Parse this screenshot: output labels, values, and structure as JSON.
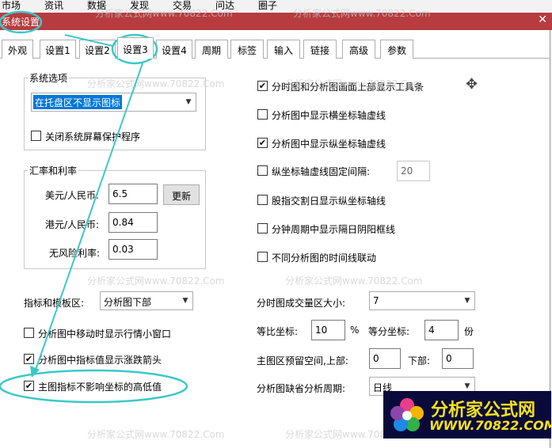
{
  "menubar": {
    "items": [
      "市场",
      "资讯",
      "数据",
      "发现",
      "交易",
      "问达",
      "圈子"
    ]
  },
  "window": {
    "title": "系统设置",
    "close_label": "✕"
  },
  "tabs": [
    "外观",
    "设置1",
    "设置2",
    "设置3",
    "设置4",
    "周期",
    "标签",
    "输入",
    "链接",
    "高级",
    "参数"
  ],
  "active_tab": "设置3",
  "system_options": {
    "legend": "系统选项",
    "tray_combo_value": "在托盘区不显示图标",
    "disable_screensaver": {
      "label": "关闭系统屏幕保护程序",
      "checked": false
    }
  },
  "exchange": {
    "legend": "汇率和利率",
    "usd_label": "美元/人民币:",
    "usd_value": "6.5",
    "update_button": "更新",
    "hkd_label": "港元/人民币:",
    "hkd_value": "0.84",
    "riskfree_label": "无风险利率:",
    "riskfree_value": "0.03"
  },
  "right_checks": [
    {
      "label": "分时图和分析图画面上部显示工具条",
      "checked": true
    },
    {
      "label": "分析图中显示横坐标轴虚线",
      "checked": false
    },
    {
      "label": "分析图中显示纵坐标轴虚线",
      "checked": true
    },
    {
      "label": "纵坐标轴虚线固定间隔:",
      "checked": false
    },
    {
      "label": "股指交割日显示纵坐标轴线",
      "checked": false
    },
    {
      "label": "分钟周期中显示隔日阴阳框线",
      "checked": false
    },
    {
      "label": "不同分析图的时间线联动",
      "checked": false
    }
  ],
  "fixed_interval_value": "20",
  "indicator_panel": {
    "label": "指标和模板区:",
    "value": "分析图下部"
  },
  "left_checks": [
    {
      "label": "分析图中移动时显示行情小窗口",
      "checked": false
    },
    {
      "label": "分析图中指标值显示涨跌箭头",
      "checked": true
    },
    {
      "label": "主图指标不影响坐标的高低值",
      "checked": true
    }
  ],
  "volume_area": {
    "label": "分时图成交量区大小:",
    "value": "7"
  },
  "ratio": {
    "label": "等比坐标:",
    "value": "10",
    "unit": "%",
    "equal_label": "等分坐标:",
    "equal_value": "4",
    "equal_unit": "份"
  },
  "reserve": {
    "label": "主图区预留空间,上部:",
    "top_value": "0",
    "bottom_label": "下部:",
    "bottom_value": "0"
  },
  "default_period": {
    "label": "分析图缺省分析周期:",
    "value": "日线"
  },
  "logo": {
    "name": "分析家公式网",
    "url": "WWW.70822.COM"
  },
  "watermark": "分析家公式网www.70822.Com",
  "colors": {
    "title_bar": "#b63c40",
    "highlight": "#0078d7",
    "annotation": "#3cc8c8"
  }
}
